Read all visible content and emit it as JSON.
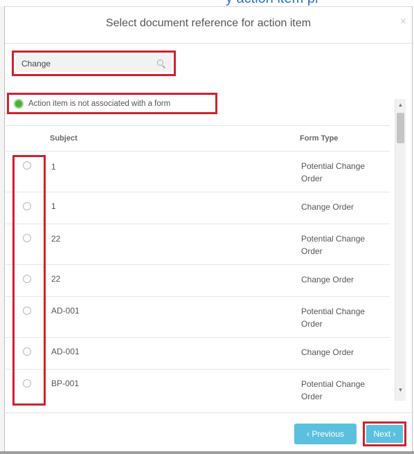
{
  "background_fragment": "y action item pl",
  "dialog": {
    "title": "Select document reference for action item",
    "close_symbol": "×"
  },
  "search": {
    "value": "Change",
    "icon": "search-icon"
  },
  "no_form_option": {
    "label": "Action item is not associated with a form",
    "selected": true
  },
  "table": {
    "columns": [
      "Subject",
      "Form Type"
    ],
    "rows": [
      {
        "subject": "1",
        "form_type": "Potential Change Order"
      },
      {
        "subject": "1",
        "form_type": "Change Order"
      },
      {
        "subject": "22",
        "form_type": "Potential Change Order"
      },
      {
        "subject": "22",
        "form_type": "Change Order"
      },
      {
        "subject": "AD-001",
        "form_type": "Potential Change Order"
      },
      {
        "subject": "AD-001",
        "form_type": "Change Order"
      },
      {
        "subject": "BP-001",
        "form_type": "Potential Change Order"
      }
    ]
  },
  "footer": {
    "previous_label": "‹ Previous",
    "next_label": "Next ›"
  },
  "colors": {
    "button": "#5bc0de",
    "highlight": "#d0202e",
    "radio_selected": "#4cae3b"
  }
}
